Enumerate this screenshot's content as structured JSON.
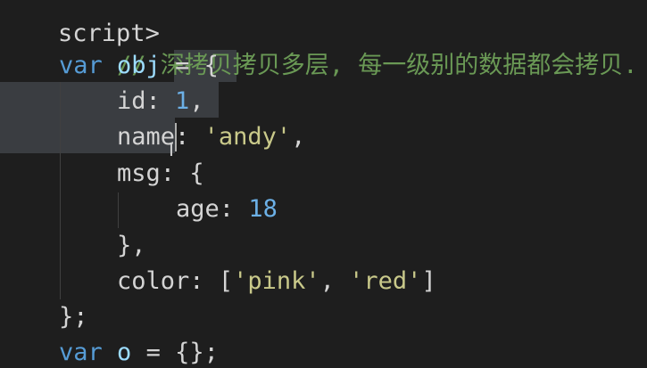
{
  "editor": {
    "top_partial": "script>",
    "comment": "// 深拷贝拷贝多层, 每一级别的数据都会拷贝.",
    "line_var_obj": {
      "kw": "var",
      "name": "obj",
      "op": "=",
      "brace": "{"
    },
    "line_id": {
      "key": "id",
      "colon": ":",
      "value": "1",
      "comma": ","
    },
    "line_name": {
      "key": "name",
      "colon": ":",
      "value": "'andy'",
      "comma": ","
    },
    "line_msg": {
      "key": "msg",
      "colon": ":",
      "brace": "{"
    },
    "line_age": {
      "key": "age",
      "colon": ":",
      "value": "18"
    },
    "line_msg_close": "},",
    "line_color": {
      "key": "color",
      "colon": ":",
      "open": "[",
      "items": [
        "'pink'",
        "'red'"
      ],
      "sep": ",",
      "close": "]"
    },
    "line_obj_close": "};",
    "line_var_o": {
      "kw": "var",
      "name": "o",
      "op": "=",
      "value": "{};"
    }
  }
}
